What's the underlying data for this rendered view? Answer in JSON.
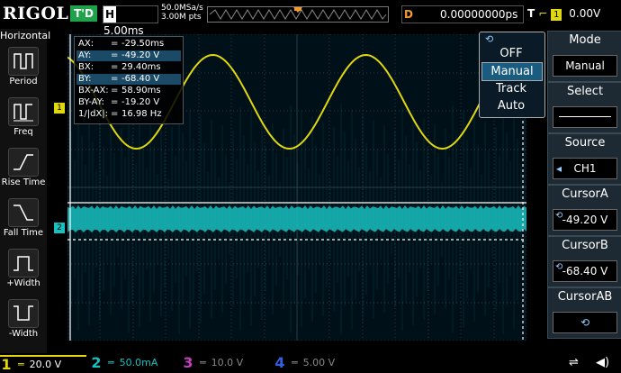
{
  "header": {
    "brand": "RIGOL",
    "trigger_status": "T'D",
    "horizontal_label": "H",
    "timebase": "5.00ms",
    "sample_rate": "50.0MSa/s",
    "memory_depth": "3.00M pts",
    "delay_label": "D",
    "delay": "0.00000000ps",
    "trigger_label": "T",
    "trigger_source": "1",
    "trigger_level": "0.00V"
  },
  "left_panel": {
    "title": "Horizontal",
    "buttons": [
      "Period",
      "Freq",
      "Rise Time",
      "Fall Time",
      "+Width",
      "-Width"
    ]
  },
  "cursor_readout": {
    "rows": [
      {
        "key": "AX:",
        "value": "-29.50ms"
      },
      {
        "key": "AY:",
        "value": "-49.20 V"
      },
      {
        "key": "BX:",
        "value": "29.40ms"
      },
      {
        "key": "BY:",
        "value": "-68.40 V"
      },
      {
        "key": "BX-AX:",
        "value": "58.90ms"
      },
      {
        "key": "BY-AY:",
        "value": "-19.20 V"
      },
      {
        "key": "1/|dX|:",
        "value": "16.98 Hz"
      }
    ],
    "equals": "="
  },
  "mode_popup": {
    "items": [
      "OFF",
      "Manual",
      "Track",
      "Auto"
    ],
    "selected": "Manual"
  },
  "menu": {
    "mode": {
      "title": "Mode",
      "value": "Manual"
    },
    "select": {
      "title": "Select"
    },
    "source": {
      "title": "Source",
      "value": "CH1"
    },
    "cursor_a": {
      "title": "CursorA",
      "value": "-49.20 V"
    },
    "cursor_b": {
      "title": "CursorB",
      "value": "-68.40 V"
    },
    "cursor_ab": {
      "title": "CursorAB"
    }
  },
  "channels": [
    {
      "num": "1",
      "scale": "20.0 V",
      "color": "#e0d80a"
    },
    {
      "num": "2",
      "scale": "50.0mA",
      "color": "#18c0c0"
    },
    {
      "num": "3",
      "scale": "10.0 V",
      "color": "#c040c0"
    },
    {
      "num": "4",
      "scale": "5.00 V",
      "color": "#3060e0"
    }
  ],
  "markers": {
    "ch1": "1",
    "ch2": "2"
  },
  "colors": {
    "ch1": "#e0d80a",
    "ch2": "#18c0c0",
    "accent": "#f39b2e",
    "trig_ok": "#1fa34a"
  },
  "icons": {
    "usb": "usb-icon",
    "speaker": "speaker-icon",
    "rotate": "rotate-knob-icon"
  }
}
